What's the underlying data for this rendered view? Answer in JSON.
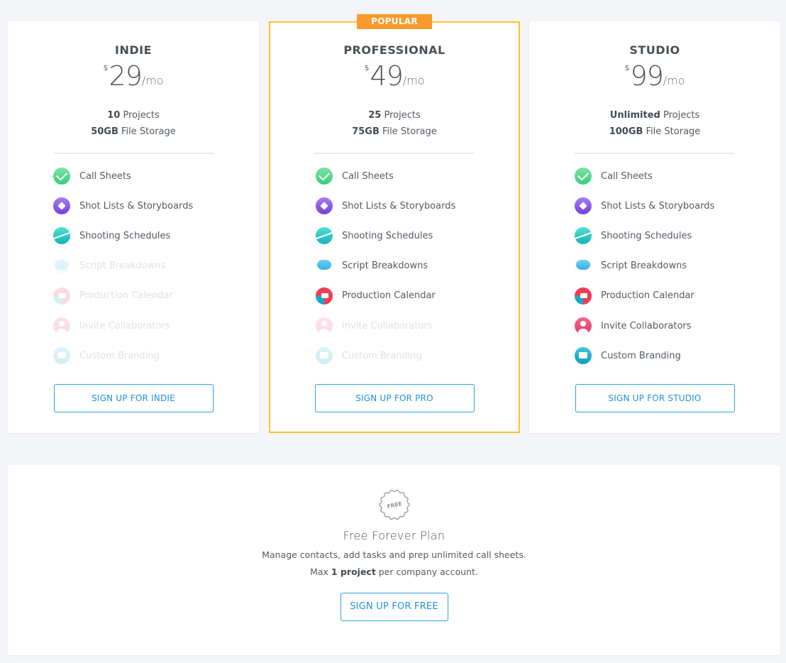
{
  "plans": [
    {
      "id": "indie",
      "name": "INDIE",
      "currency": "$",
      "price": "29",
      "period": "/mo",
      "projects_value": "10",
      "projects_label": " Projects",
      "storage_value": "50GB",
      "storage_label": " File Storage",
      "cta": "SIGN UP FOR INDIE",
      "features": [
        {
          "label": "Call Sheets",
          "icon": "call-sheets-icon",
          "included": true
        },
        {
          "label": "Shot Lists & Storyboards",
          "icon": "shot-lists-icon",
          "included": true
        },
        {
          "label": "Shooting Schedules",
          "icon": "shooting-schedules-icon",
          "included": true
        },
        {
          "label": "Script Breakdowns",
          "icon": "script-breakdowns-icon",
          "included": false
        },
        {
          "label": "Production Calendar",
          "icon": "production-calendar-icon",
          "included": false
        },
        {
          "label": "Invite Collaborators",
          "icon": "invite-collaborators-icon",
          "included": false
        },
        {
          "label": "Custom Branding",
          "icon": "custom-branding-icon",
          "included": false
        }
      ]
    },
    {
      "id": "pro",
      "name": "PROFESSIONAL",
      "badge": "POPULAR",
      "currency": "$",
      "price": "49",
      "period": "/mo",
      "projects_value": "25",
      "projects_label": " Projects",
      "storage_value": "75GB",
      "storage_label": " File Storage",
      "cta": "SIGN UP FOR PRO",
      "features": [
        {
          "label": "Call Sheets",
          "icon": "call-sheets-icon",
          "included": true
        },
        {
          "label": "Shot Lists & Storyboards",
          "icon": "shot-lists-icon",
          "included": true
        },
        {
          "label": "Shooting Schedules",
          "icon": "shooting-schedules-icon",
          "included": true
        },
        {
          "label": "Script Breakdowns",
          "icon": "script-breakdowns-icon",
          "included": true
        },
        {
          "label": "Production Calendar",
          "icon": "production-calendar-icon",
          "included": true
        },
        {
          "label": "Invite Collaborators",
          "icon": "invite-collaborators-icon",
          "included": false
        },
        {
          "label": "Custom Branding",
          "icon": "custom-branding-icon",
          "included": false
        }
      ]
    },
    {
      "id": "studio",
      "name": "STUDIO",
      "currency": "$",
      "price": "99",
      "period": "/mo",
      "projects_value": "Unlimited",
      "projects_label": " Projects",
      "storage_value": "100GB",
      "storage_label": " File Storage",
      "cta": "SIGN UP FOR STUDIO",
      "features": [
        {
          "label": "Call Sheets",
          "icon": "call-sheets-icon",
          "included": true
        },
        {
          "label": "Shot Lists & Storyboards",
          "icon": "shot-lists-icon",
          "included": true
        },
        {
          "label": "Shooting Schedules",
          "icon": "shooting-schedules-icon",
          "included": true
        },
        {
          "label": "Script Breakdowns",
          "icon": "script-breakdowns-icon",
          "included": true
        },
        {
          "label": "Production Calendar",
          "icon": "production-calendar-icon",
          "included": true
        },
        {
          "label": "Invite Collaborators",
          "icon": "invite-collaborators-icon",
          "included": true
        },
        {
          "label": "Custom Branding",
          "icon": "custom-branding-icon",
          "included": true
        }
      ]
    }
  ],
  "free_plan": {
    "seal_text": "FREE",
    "title": "Free Forever Plan",
    "description": "Manage contacts, add tasks and prep unlimited call sheets.",
    "limit_prefix": "Max ",
    "limit_value": "1 project",
    "limit_suffix": " per company account.",
    "cta": "SIGN UP FOR FREE"
  },
  "colors": {
    "accent": "#2392d6",
    "popular_border": "#fbc331",
    "popular_badge": "#fa9a2b",
    "background": "#f3f5f8"
  }
}
